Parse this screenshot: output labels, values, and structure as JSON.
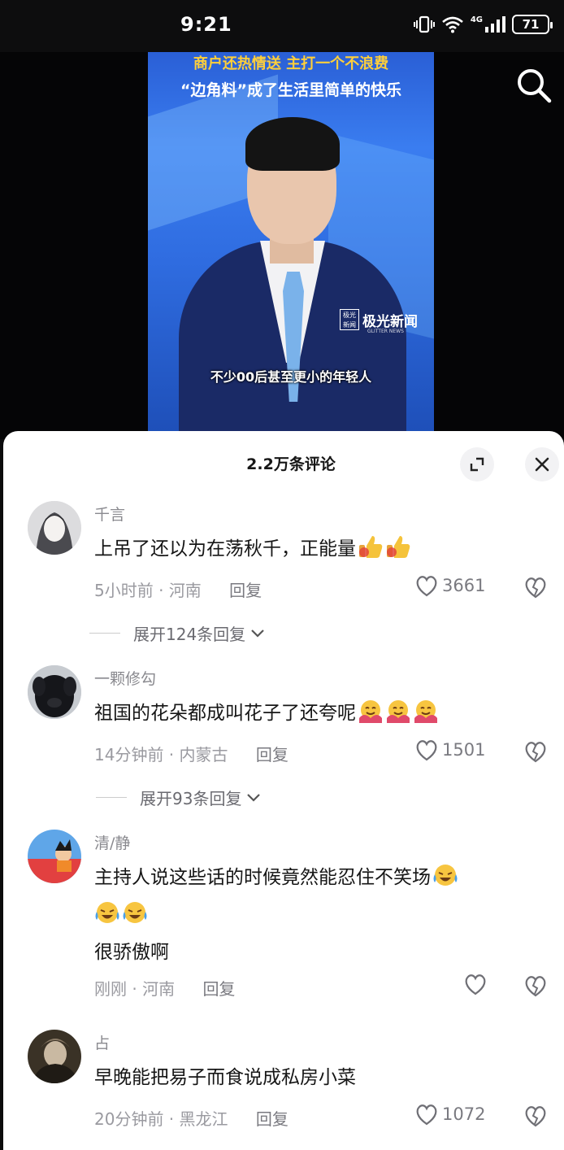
{
  "status_bar": {
    "time": "9:21",
    "network": "4G",
    "battery": "71"
  },
  "video": {
    "headline_line1": "商户还热情送 主打一个不浪费",
    "headline_line2": "“边角料”成了生活里简单的快乐",
    "subtitle": "不少00后甚至更小的年轻人",
    "logo_seal": "极光新闻",
    "logo_name": "极光新闻",
    "logo_sub": "GLITTER NEWS",
    "search_icon": "search-icon"
  },
  "comments_panel": {
    "title": "2.2万条评论",
    "expand_icon": "expand-icon",
    "close_icon": "close-icon"
  },
  "comments": [
    {
      "name": "千言",
      "text": "上吊了还以为在荡秋千，正能量",
      "emojis": [
        "thumbs-up",
        "thumbs-up"
      ],
      "time": "5小时前",
      "region": "河南",
      "reply": "回复",
      "likes": "3661",
      "expand": "展开124条回复"
    },
    {
      "name": "一颗修勾",
      "text": "祖国的花朵都成叫花子了还夸呢",
      "emojis": [
        "hug",
        "hug",
        "hug"
      ],
      "time": "14分钟前",
      "region": "内蒙古",
      "reply": "回复",
      "likes": "1501",
      "expand": "展开93条回复"
    },
    {
      "name": "清/静",
      "text": "主持人说这些话的时候竟然能忍住不笑场",
      "emojis": [
        "laugh-cry"
      ],
      "line2_emojis": [
        "laugh-cry",
        "laugh-cry"
      ],
      "line3": "很骄傲啊",
      "time": "刚刚",
      "region": "河南",
      "reply": "回复",
      "likes": ""
    },
    {
      "name": "占",
      "text": "早晚能把易子而食说成私房小菜",
      "time": "20分钟前",
      "region": "黑龙江",
      "reply": "回复",
      "likes": "1072"
    }
  ],
  "colors": {
    "accent_blue": "#2f6ce0",
    "headline_yellow": "#ffcf3a",
    "text_dark": "#161616",
    "text_gray": "#9a9aa0"
  }
}
